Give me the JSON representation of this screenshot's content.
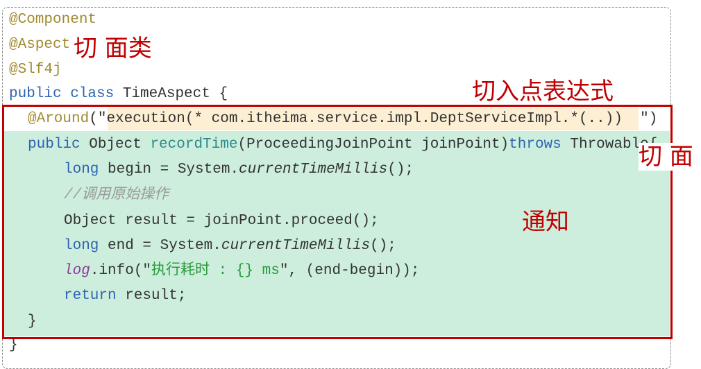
{
  "code_lines": [
    [
      {
        "t": "@Component",
        "c": "ann"
      }
    ],
    [
      {
        "t": "@Aspect",
        "c": "ann"
      }
    ],
    [
      {
        "t": "@Slf4j",
        "c": "ann"
      }
    ],
    [
      {
        "t": "public class ",
        "c": "kw"
      },
      {
        "t": "TimeAspect {",
        "c": ""
      }
    ],
    [
      {
        "t": "@Around",
        "c": "ann"
      },
      {
        "t": "(\"",
        "c": ""
      },
      {
        "t": "execution(* com.itheima.service.impl.DeptServiceImpl.*(..))  ",
        "c": ""
      },
      {
        "t": "\")",
        "c": ""
      }
    ],
    [
      {
        "t": "public ",
        "c": "kw"
      },
      {
        "t": "Object ",
        "c": ""
      },
      {
        "t": "recordTime",
        "c": "fn"
      },
      {
        "t": "(ProceedingJoinPoint joinPoint)",
        "c": ""
      },
      {
        "t": "throws ",
        "c": "kw"
      },
      {
        "t": "Throwable{",
        "c": ""
      }
    ],
    [
      {
        "t": "long ",
        "c": "kw"
      },
      {
        "t": "begin = System.",
        "c": ""
      },
      {
        "t": "currentTimeMillis",
        "c": "it"
      },
      {
        "t": "();",
        "c": ""
      }
    ],
    [
      {
        "t": "//调用原始操作",
        "c": "cm"
      }
    ],
    [
      {
        "t": "Object result = joinPoint.proceed();",
        "c": ""
      }
    ],
    [
      {
        "t": "long ",
        "c": "kw"
      },
      {
        "t": "end = System.",
        "c": ""
      },
      {
        "t": "currentTimeMillis",
        "c": "it"
      },
      {
        "t": "();",
        "c": ""
      }
    ],
    [
      {
        "t": "log",
        "c": "fld"
      },
      {
        "t": ".info(\"",
        "c": ""
      },
      {
        "t": "执行耗时 : {} ms",
        "c": "str"
      },
      {
        "t": "\", (end-begin));",
        "c": ""
      }
    ],
    [
      {
        "t": "return ",
        "c": "kw"
      },
      {
        "t": "result;",
        "c": ""
      }
    ],
    [
      {
        "t": "}",
        "c": ""
      }
    ],
    [
      {
        "t": "}",
        "c": ""
      }
    ]
  ],
  "labels": {
    "aspect_class": "切 面类",
    "pointcut_expression": "切入点表达式",
    "aspect": "切 面",
    "advice": "通知"
  },
  "colors": {
    "annotation_box": "#c00000",
    "advice_background": "#cdeedd",
    "pointcut_highlight": "#fdefd3"
  }
}
